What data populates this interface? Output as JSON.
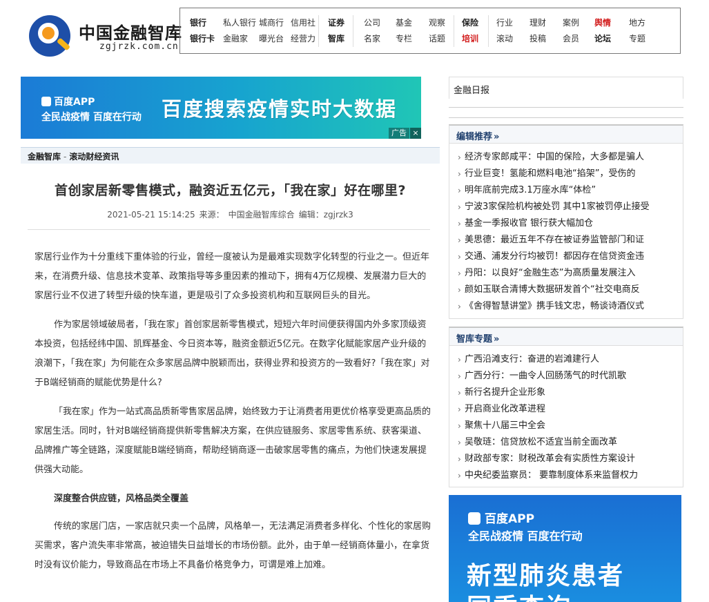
{
  "header": {
    "logo_title": "中国金融智库",
    "logo_url": "zgjrzk.com.cn",
    "nav_columns": [
      {
        "top": "银行",
        "bottom": "银行卡",
        "top_bold": true,
        "bottom_bold": true
      },
      {
        "top": "私人银行",
        "bottom": "金融家"
      },
      {
        "top": "城商行",
        "bottom": "曝光台"
      },
      {
        "top": "信用社",
        "bottom": "经营力"
      },
      {
        "top": "证券",
        "bottom": "智库",
        "top_bold": true,
        "bottom_bold": true
      },
      {
        "top": "公司",
        "bottom": "名家"
      },
      {
        "top": "基金",
        "bottom": "专栏"
      },
      {
        "top": "观察",
        "bottom": "话题"
      },
      {
        "top": "保险",
        "bottom": "培训",
        "top_bold": true,
        "bottom_red": true
      },
      {
        "top": "行业",
        "bottom": "滚动"
      },
      {
        "top": "理财",
        "bottom": "投稿"
      },
      {
        "top": "案例",
        "bottom": "会员"
      },
      {
        "top": "舆情",
        "bottom": "论坛",
        "top_red": true,
        "bottom_bold": true
      },
      {
        "top": "地方",
        "bottom": "专题"
      }
    ]
  },
  "ad_top": {
    "app": "百度APP",
    "slogan": "全民战疫情 百度在行动",
    "headline": "百度搜索疫情实时大数据",
    "tag": "广告",
    "close": "×"
  },
  "breadcrumb": {
    "home": "金融智库",
    "separator": "-",
    "section": "滚动财经资讯"
  },
  "article": {
    "title": "首创家居新零售模式，融资近五亿元，「我在家」好在哪里?",
    "datetime": "2021-05-21 15:14:25",
    "source_label": "来源：",
    "source": "中国金融智库综合",
    "editor_label": "编辑：",
    "editor": "zgjrzk3",
    "paragraphs": [
      "家居行业作为十分重线下重体验的行业，曾经一度被认为是最难实现数字化转型的行业之一。但近年来，在消费升级、信息技术变革、政策指导等多重因素的推动下，拥有4万亿规模、发展潜力巨大的家居行业不仅进了转型升级的快车道，更是吸引了众多投资机构和互联网巨头的目光。",
      "作为家居领域破局者，「我在家」首创家居新零售模式，短短六年时间便获得国内外多家顶级资本投资，包括经纬中国、凯辉基金、今日资本等，融资金额近5亿元。在数字化赋能家居产业升级的浪潮下，「我在家」为何能在众多家居品牌中脱颖而出，获得业界和投资方的一致看好?「我在家」对于B端经销商的赋能优势是什么?",
      "「我在家」作为一站式高品质新零售家居品牌，始终致力于让消费者用更优价格享受更高品质的家居生活。同时，针对B端经销商提供新零售解决方案，在供应链服务、家居零售系统、获客渠道、品牌推广等全链路，深度赋能B端经销商，帮助经销商逐一击破家居零售的痛点，为他们快速发展提供强大动能。",
      "深度整合供应链，风格品类全覆盖",
      "传统的家居门店，一家店就只卖一个品牌，风格单一，无法满足消费者多样化、个性化的家居购买需求，客户流失率非常高，被迫错失日益增长的市场份额。此外，由于单一经销商体量小，在拿货时没有议价能力，导致商品在市场上不具备价格竞争力，可谓是难上加难。"
    ]
  },
  "sidebar": {
    "image_alt": "金融日报",
    "editor_pick": {
      "title": "编辑推荐",
      "arrow": "»",
      "items": [
        "经济专家郎咸平：中国的保险，大多都是骗人",
        "行业巨变！氢能和燃料电池“掐架”，受伤的",
        "明年底前完成3.1万座水库“体检”",
        "宁波3家保险机构被处罚 其中1家被罚停止接受",
        "基金一季报收官 银行获大幅加仓",
        "美思德：最近五年不存在被证券监管部门和证",
        "交通、浦发分行均被罚！都因存在信贷资金违",
        "丹阳：以良好“金融生态”为高质量发展注入",
        "颜如玉联合清博大数据研发首个“社交电商反",
        "《舍得智慧讲堂》携手钱文忠，畅谈诗酒仪式"
      ]
    },
    "topics": {
      "title": "智库专题",
      "arrow": "»",
      "items": [
        "广西沿滩支行：奋进的岩滩建行人",
        "广西分行：一曲令人回肠荡气的时代凯歌",
        "新行名提升企业形象",
        "开启商业化改革进程",
        "聚焦十八届三中全会",
        "吴敬琏：信贷放松不适宜当前全面改革",
        "财政部专家：财税改革会有实质性方案设计",
        "中央纪委监察员： 要靠制度体系来监督权力"
      ]
    },
    "ad": {
      "app": "百度APP",
      "slogan": "全民战疫情 百度在行动",
      "line1": "新型肺炎患者",
      "line2": "同乘查询"
    }
  }
}
